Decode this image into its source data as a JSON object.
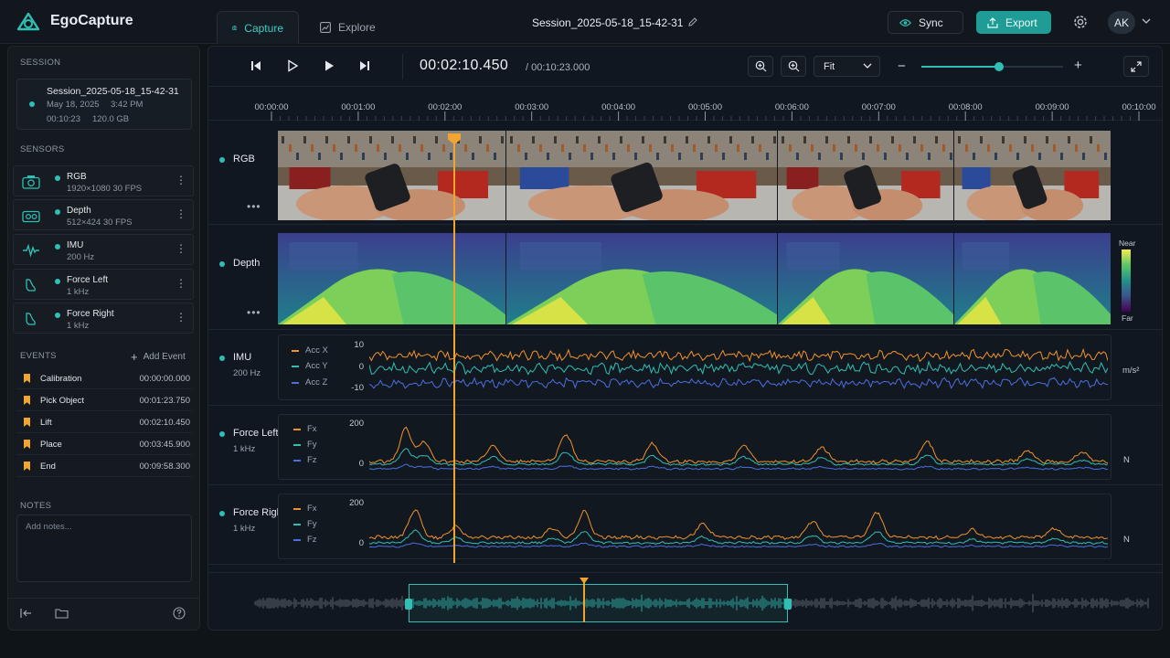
{
  "app": {
    "title": "EgoCapture"
  },
  "header": {
    "tabs": [
      {
        "label": "Capture",
        "icon": "camera-icon"
      },
      {
        "label": "Explore",
        "icon": "chart-icon"
      }
    ],
    "session_title": "Session_2025-05-18_15-42-31",
    "sync_label": "Sync",
    "export_label": "Export",
    "avatar_initials": "AK"
  },
  "sidebar": {
    "session_label": "SESSION",
    "session": {
      "name": "Session_2025-05-18_15-42-31",
      "date": "May 18, 2025",
      "time": "3:42 PM",
      "duration": "00:10:23",
      "size": "120.0 GB"
    },
    "sensors_label": "SENSORS",
    "sensors": [
      {
        "name": "RGB",
        "detail": "1920×1080   30 FPS",
        "icon": "camera-icon"
      },
      {
        "name": "Depth",
        "detail": "512×424   30 FPS",
        "icon": "depth-camera-icon"
      },
      {
        "name": "IMU",
        "detail": "200 Hz",
        "icon": "waveform-icon"
      },
      {
        "name": "Force Left",
        "detail": "1 kHz",
        "icon": "foot-icon"
      },
      {
        "name": "Force Right",
        "detail": "1 kHz",
        "icon": "foot-icon"
      }
    ],
    "events_label": "EVENTS",
    "add_event_label": "Add Event",
    "events": [
      {
        "name": "Calibration",
        "time": "00:00:00.000"
      },
      {
        "name": "Pick Object",
        "time": "00:01:23.750"
      },
      {
        "name": "Lift",
        "time": "00:02:10.450"
      },
      {
        "name": "Place",
        "time": "00:03:45.900"
      },
      {
        "name": "End",
        "time": "00:09:58.300"
      }
    ],
    "notes_label": "NOTES",
    "notes_placeholder": "Add notes..."
  },
  "transport": {
    "current_time": "00:02:10.450",
    "total_time": "/ 00:10:23.000",
    "fit_label": "Fit",
    "zoom_level": 0.55
  },
  "ruler": {
    "ticks": [
      "00:00:00",
      "00:01:00",
      "00:02:00",
      "00:03:00",
      "00:04:00",
      "00:05:00",
      "00:06:00",
      "00:07:00",
      "00:08:00",
      "00:09:00",
      "00:10:00"
    ]
  },
  "tracks": {
    "rgb": {
      "name": "RGB"
    },
    "depth": {
      "name": "Depth",
      "scale_near": "Near",
      "scale_far": "Far"
    },
    "imu": {
      "name": "IMU",
      "rate": "200 Hz",
      "legend": [
        "Acc X",
        "Acc Y",
        "Acc Z"
      ],
      "yticks": [
        "10",
        "0",
        "-10"
      ],
      "unit": "m/s²"
    },
    "force_left": {
      "name": "Force Left",
      "rate": "1 kHz",
      "legend": [
        "Fx",
        "Fy",
        "Fz"
      ],
      "yticks": [
        "200",
        "0"
      ],
      "unit": "N"
    },
    "force_right": {
      "name": "Force Right",
      "rate": "1 kHz",
      "legend": [
        "Fx",
        "Fy",
        "Fz"
      ],
      "yticks": [
        "200",
        "0"
      ],
      "unit": "N"
    }
  },
  "colors": {
    "accent": "#2fbfb4",
    "playhead": "#f2a431",
    "series_x": "#f0922b",
    "series_y": "#2fbfb4",
    "series_z": "#4a6fe0"
  }
}
